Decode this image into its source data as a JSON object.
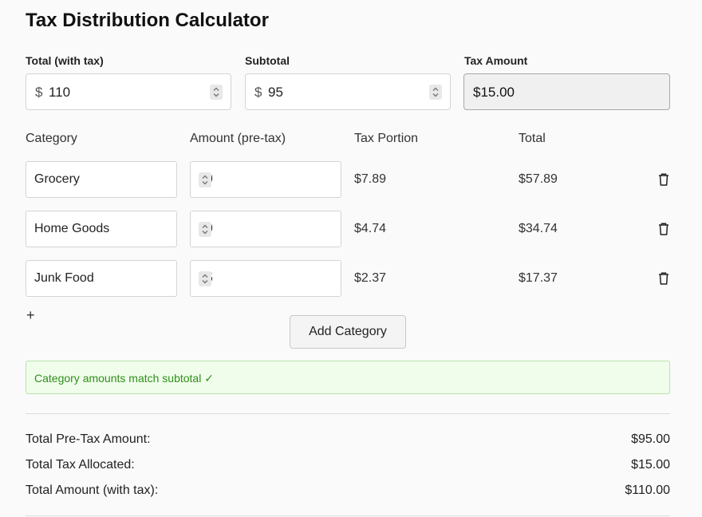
{
  "title": "Tax Distribution Calculator",
  "inputs": {
    "total_label": "Total (with tax)",
    "total_prefix": "$",
    "total_value": "110",
    "subtotal_label": "Subtotal",
    "subtotal_prefix": "$",
    "subtotal_value": "95",
    "tax_label": "Tax Amount",
    "tax_value": "$15.00"
  },
  "table": {
    "headers": [
      "Category",
      "Amount (pre-tax)",
      "Tax Portion",
      "Total"
    ],
    "rows": [
      {
        "category": "Grocery",
        "amount": "50",
        "tax": "$7.89",
        "total": "$57.89"
      },
      {
        "category": "Home Goods",
        "amount": "30",
        "tax": "$4.74",
        "total": "$34.74"
      },
      {
        "category": "Junk Food",
        "amount": "15",
        "tax": "$2.37",
        "total": "$17.37"
      }
    ]
  },
  "add_icon_glyph": "+",
  "add_button_label": "Add Category",
  "status": {
    "text": "Category amounts match subtotal ✓",
    "color": "#2f8f1a"
  },
  "summary": {
    "pretax_label": "Total Pre-Tax Amount:",
    "pretax_value": "$95.00",
    "tax_label": "Total Tax Allocated:",
    "tax_value": "$15.00",
    "total_label": "Total Amount (with tax):",
    "total_value": "$110.00"
  },
  "icons": {
    "delete": "trash-icon",
    "spinner": "spinner-icon",
    "add": "plus-icon"
  }
}
